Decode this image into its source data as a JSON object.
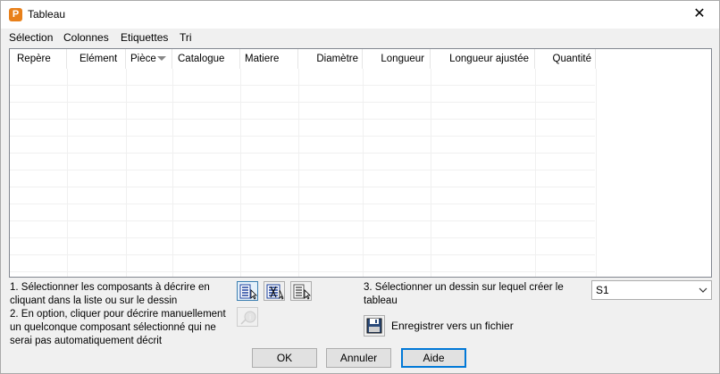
{
  "window": {
    "title": "Tableau",
    "app_icon": "P",
    "close": "✕"
  },
  "menu": [
    "Sélection",
    "Colonnes",
    "Etiquettes",
    "Tri"
  ],
  "table": {
    "columns": [
      {
        "label": "Repère"
      },
      {
        "label": "Elément"
      },
      {
        "label": "Pièce",
        "sorted": true
      },
      {
        "label": "Catalogue"
      },
      {
        "label": "Matiere"
      },
      {
        "label": "Diamètre"
      },
      {
        "label": "Longueur"
      },
      {
        "label": "Longueur ajustée"
      },
      {
        "label": "Quantité"
      }
    ],
    "rows": []
  },
  "instructions": {
    "step1": "1. Sélectionner les composants à décrire en cliquant dans la liste ou sur le dessin",
    "step2": "2. En option, cliquer pour décrire manuellement un quelconque composant sélectionné qui ne serai pas automatiquement décrit",
    "step3": "3. Sélectionner un dessin sur lequel créer le tableau"
  },
  "drawing_select": {
    "value": "S1"
  },
  "save": {
    "label": "Enregistrer vers un fichier"
  },
  "buttons": {
    "ok": "OK",
    "cancel": "Annuler",
    "help": "Aide"
  },
  "colors": {
    "accent": "#0078d7",
    "app_icon": "#e8801a"
  }
}
